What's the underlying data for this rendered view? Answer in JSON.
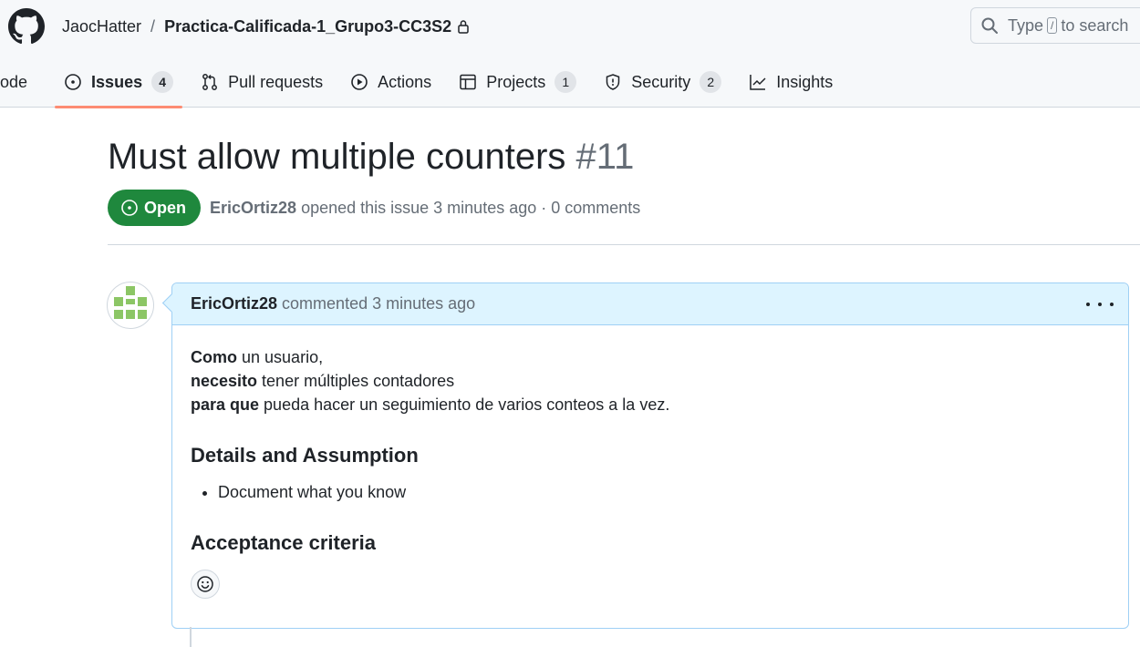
{
  "header": {
    "owner": "JaocHatter",
    "separator": "/",
    "repo": "Practica-Calificada-1_Grupo3-CC3S2",
    "search": {
      "prefix": "Type",
      "key": "/",
      "suffix": "to search"
    }
  },
  "tabs": [
    {
      "label": "ode",
      "icon": "code-icon",
      "count": null
    },
    {
      "label": "Issues",
      "icon": "issue-opened-icon",
      "count": "4",
      "active": true
    },
    {
      "label": "Pull requests",
      "icon": "git-pull-request-icon",
      "count": null
    },
    {
      "label": "Actions",
      "icon": "play-icon",
      "count": null
    },
    {
      "label": "Projects",
      "icon": "table-icon",
      "count": "1"
    },
    {
      "label": "Security",
      "icon": "shield-icon",
      "count": "2"
    },
    {
      "label": "Insights",
      "icon": "graph-icon",
      "count": null
    }
  ],
  "issue": {
    "title": "Must allow multiple counters",
    "number": "#11",
    "state": "Open",
    "state_color": "#1f883d",
    "author": "EricOrtiz28",
    "meta": "opened this issue 3 minutes ago · 0 comments"
  },
  "comment": {
    "author": "EricOrtiz28",
    "meta": "commented 3 minutes ago",
    "story": [
      {
        "keyword": "Como",
        "rest": "un usuario,"
      },
      {
        "keyword": "necesito",
        "rest": "tener múltiples contadores"
      },
      {
        "keyword": "para que",
        "rest": "pueda hacer un seguimiento de varios conteos a la vez."
      }
    ],
    "details_heading": "Details and Assumption",
    "details_items": [
      "Document what you know"
    ],
    "acceptance_heading": "Acceptance criteria"
  },
  "colors": {
    "accent_underline": "#fd8c73",
    "comment_header_bg": "#ddf4ff",
    "comment_border": "#9fd0f5"
  }
}
